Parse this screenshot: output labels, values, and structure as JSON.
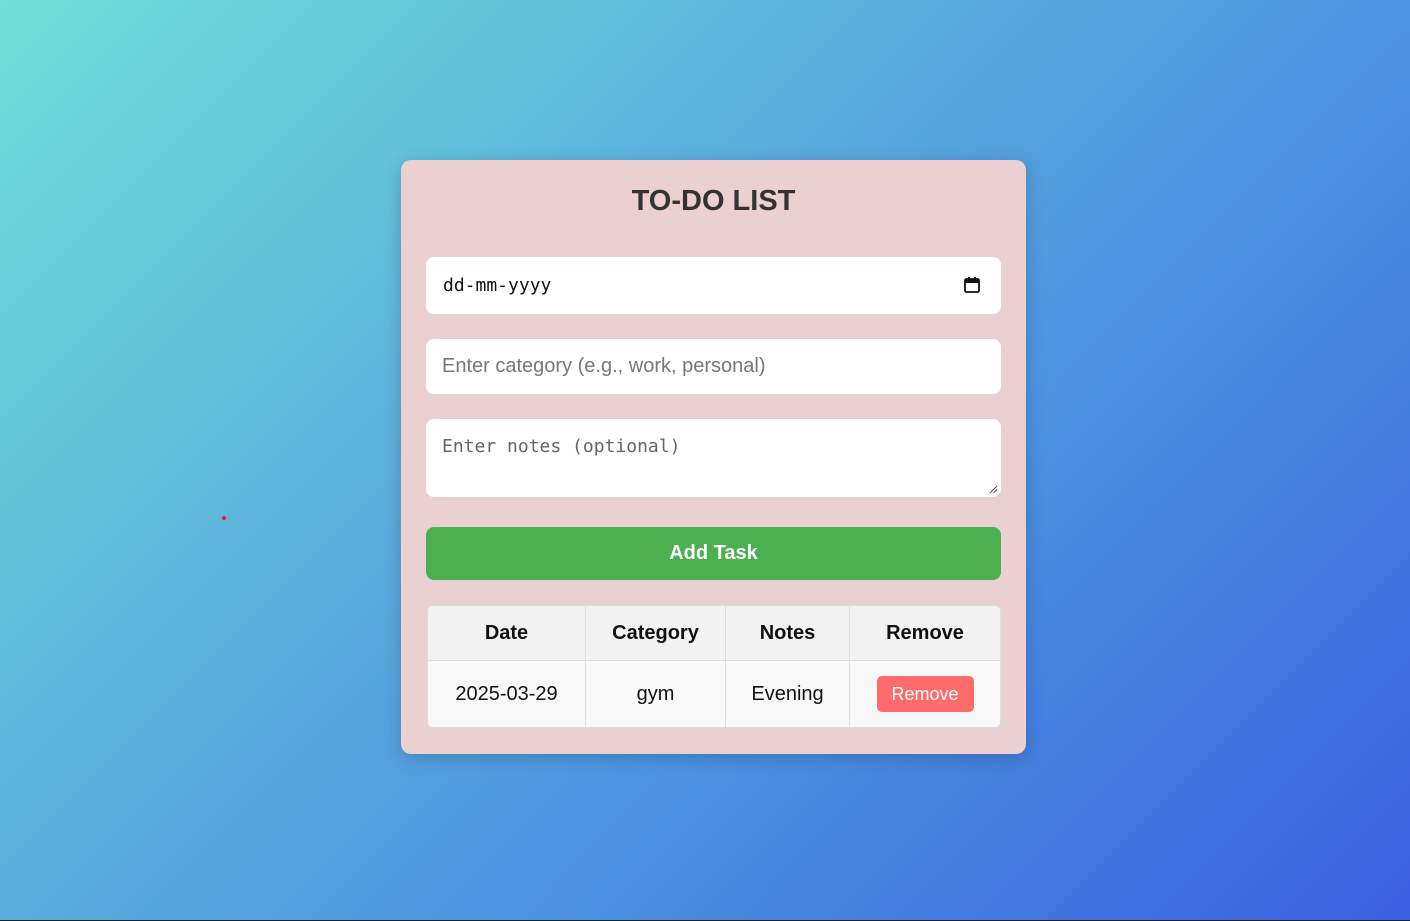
{
  "app": {
    "title": "TO-DO LIST"
  },
  "form": {
    "date_placeholder": "dd-mm-yyyy",
    "category_placeholder": "Enter category (e.g., work, personal)",
    "notes_placeholder": "Enter notes (optional)",
    "add_button_label": "Add Task"
  },
  "table": {
    "headers": [
      "Date",
      "Category",
      "Notes",
      "Remove"
    ],
    "rows": [
      {
        "date": "2025-03-29",
        "category": "gym",
        "notes": "Evening",
        "remove_label": "Remove"
      }
    ]
  },
  "icons": {
    "calendar": "calendar-icon",
    "resize": "resize-handle-icon"
  },
  "colors": {
    "card_bg": "#ebd0d1",
    "add_button": "#4caf50",
    "remove_button": "#ff6b6b",
    "title_text": "#333333"
  }
}
